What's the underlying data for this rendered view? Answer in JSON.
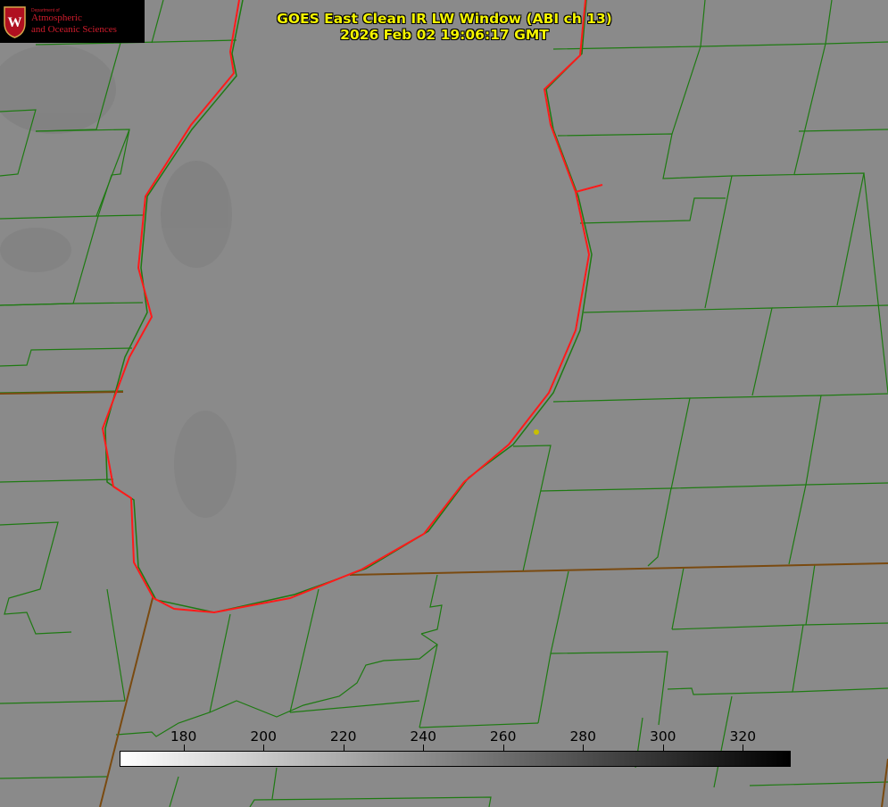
{
  "title": {
    "line1": "GOES East Clean IR LW Window (ABI ch 13)",
    "line2": "2026 Feb 02 19:06:17 GMT"
  },
  "logo": {
    "dept": "Department of",
    "line1": "Atmospheric",
    "line2": "and Oceanic Sciences"
  },
  "colorbar": {
    "range": [
      164,
      332
    ],
    "ticks": [
      "180",
      "200",
      "220",
      "240",
      "260",
      "280",
      "300",
      "320"
    ],
    "colormap": "grayscale white-to-black",
    "low_color": "#ffffff",
    "high_color": "#000000"
  },
  "map": {
    "background_color": "#8a8a8a",
    "boundary_color": "#1e7a12",
    "coastline_color": "#ff1a1a",
    "marker_color": "#c8c000"
  }
}
